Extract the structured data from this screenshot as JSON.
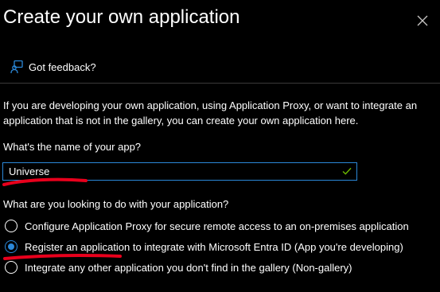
{
  "dialog": {
    "title": "Create your own application",
    "close_icon": "close-icon"
  },
  "feedback": {
    "icon": "feedback-icon",
    "label": "Got feedback?"
  },
  "intro_text": "If you are developing your own application, using Application Proxy, or want to integrate an application that is not in the gallery, you can create your own application here.",
  "app_name": {
    "label": "What's the name of your app?",
    "value": "Universe",
    "valid_icon": "check-icon"
  },
  "purpose": {
    "question": "What are you looking to do with your application?",
    "options": [
      {
        "label": "Configure Application Proxy for secure remote access to an on-premises application",
        "selected": false
      },
      {
        "label": "Register an application to integrate with Microsoft Entra ID (App you're developing)",
        "selected": true
      },
      {
        "label": "Integrate any other application you don't find in the gallery (Non-gallery)",
        "selected": false
      }
    ]
  },
  "colors": {
    "background": "#000000",
    "text": "#ffffff",
    "accent": "#2b88d8",
    "annotation": "#e8001c",
    "valid_check": "#6bb700"
  }
}
